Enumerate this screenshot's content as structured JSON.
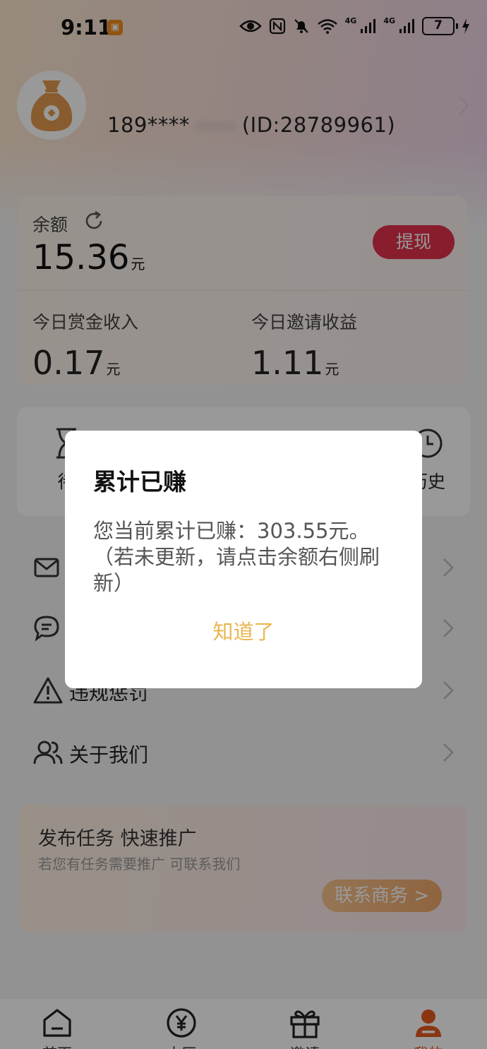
{
  "status_bar": {
    "time": "9:11",
    "app_badge": "▣",
    "net_1": "4G",
    "net_2": "4G",
    "battery": "7"
  },
  "profile": {
    "phone_masked": "189****",
    "id_text": "(ID:28789961)"
  },
  "balance": {
    "label": "余额",
    "value": "15.36",
    "unit": "元",
    "withdraw_label": "提现",
    "today_bounty_label": "今日赏金收入",
    "today_bounty_value": "0.17",
    "today_invite_label": "今日邀请收益",
    "today_invite_value": "1.11"
  },
  "shortcuts": {
    "first_label_partial": "待",
    "last_label_partial": "历史"
  },
  "menu": {
    "item3_label": "违规惩罚",
    "item4_label": "关于我们"
  },
  "promo": {
    "title": "发布任务 快速推广",
    "subtitle": "若您有任务需要推广 可联系我们",
    "button": "联系商务 >"
  },
  "nav": {
    "home": "首页",
    "hall": "大厅",
    "invite": "邀请",
    "mine": "我的",
    "active_color": "#e65a1e"
  },
  "dialog": {
    "title": "累计已赚",
    "body": "您当前累计已赚：303.55元。（若未更新，请点击余额右侧刷新）",
    "ok": "知道了"
  }
}
